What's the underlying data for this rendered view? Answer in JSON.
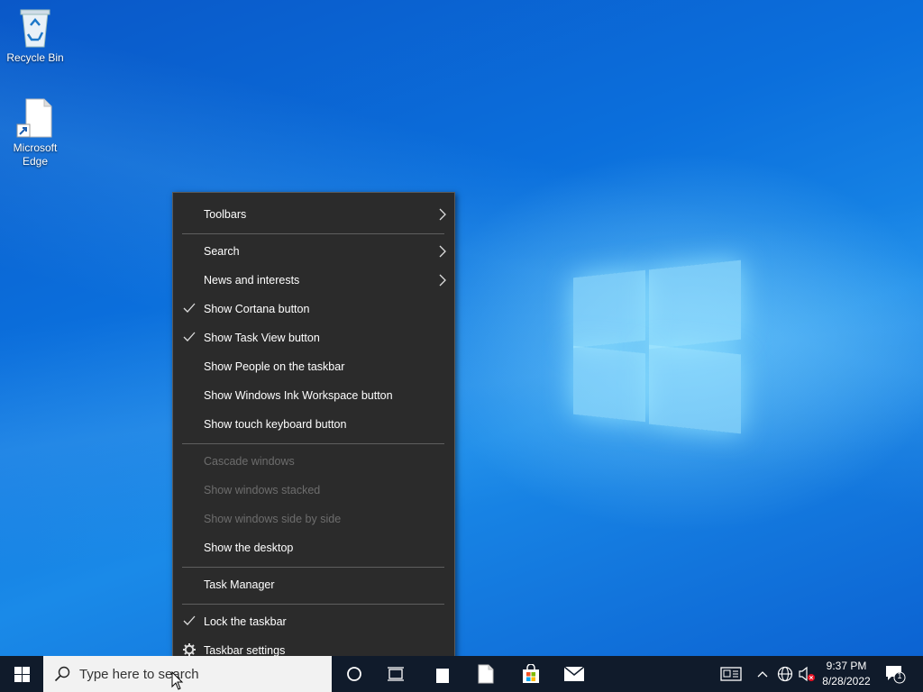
{
  "desktop": {
    "icons": [
      {
        "label": "Recycle Bin",
        "icon": "recycle-bin-icon"
      },
      {
        "label": "Microsoft Edge",
        "icon": "edge-shortcut-icon"
      }
    ]
  },
  "context_menu": {
    "items": [
      {
        "label": "Toolbars",
        "checked": false,
        "submenu": true,
        "enabled": true
      },
      {
        "label": "Search",
        "checked": false,
        "submenu": true,
        "enabled": true
      },
      {
        "label": "News and interests",
        "checked": false,
        "submenu": true,
        "enabled": true
      },
      {
        "label": "Show Cortana button",
        "checked": true,
        "submenu": false,
        "enabled": true
      },
      {
        "label": "Show Task View button",
        "checked": true,
        "submenu": false,
        "enabled": true
      },
      {
        "label": "Show People on the taskbar",
        "checked": false,
        "submenu": false,
        "enabled": true
      },
      {
        "label": "Show Windows Ink Workspace button",
        "checked": false,
        "submenu": false,
        "enabled": true
      },
      {
        "label": "Show touch keyboard button",
        "checked": false,
        "submenu": false,
        "enabled": true
      },
      {
        "label": "Cascade windows",
        "checked": false,
        "submenu": false,
        "enabled": false
      },
      {
        "label": "Show windows stacked",
        "checked": false,
        "submenu": false,
        "enabled": false
      },
      {
        "label": "Show windows side by side",
        "checked": false,
        "submenu": false,
        "enabled": false
      },
      {
        "label": "Show the desktop",
        "checked": false,
        "submenu": false,
        "enabled": true
      },
      {
        "label": "Task Manager",
        "checked": false,
        "submenu": false,
        "enabled": true
      },
      {
        "label": "Lock the taskbar",
        "checked": true,
        "submenu": false,
        "enabled": true
      },
      {
        "label": "Taskbar settings",
        "checked": false,
        "submenu": false,
        "enabled": true,
        "icon": "gear-icon"
      }
    ]
  },
  "taskbar": {
    "search_placeholder": "Type here to search",
    "time": "9:37 PM",
    "date": "8/28/2022",
    "notification_count": "1"
  },
  "colors": {
    "menu_bg": "#2b2b2b",
    "menu_disabled_text": "#6d6d6d",
    "taskbar_bg": "#101b2b"
  }
}
